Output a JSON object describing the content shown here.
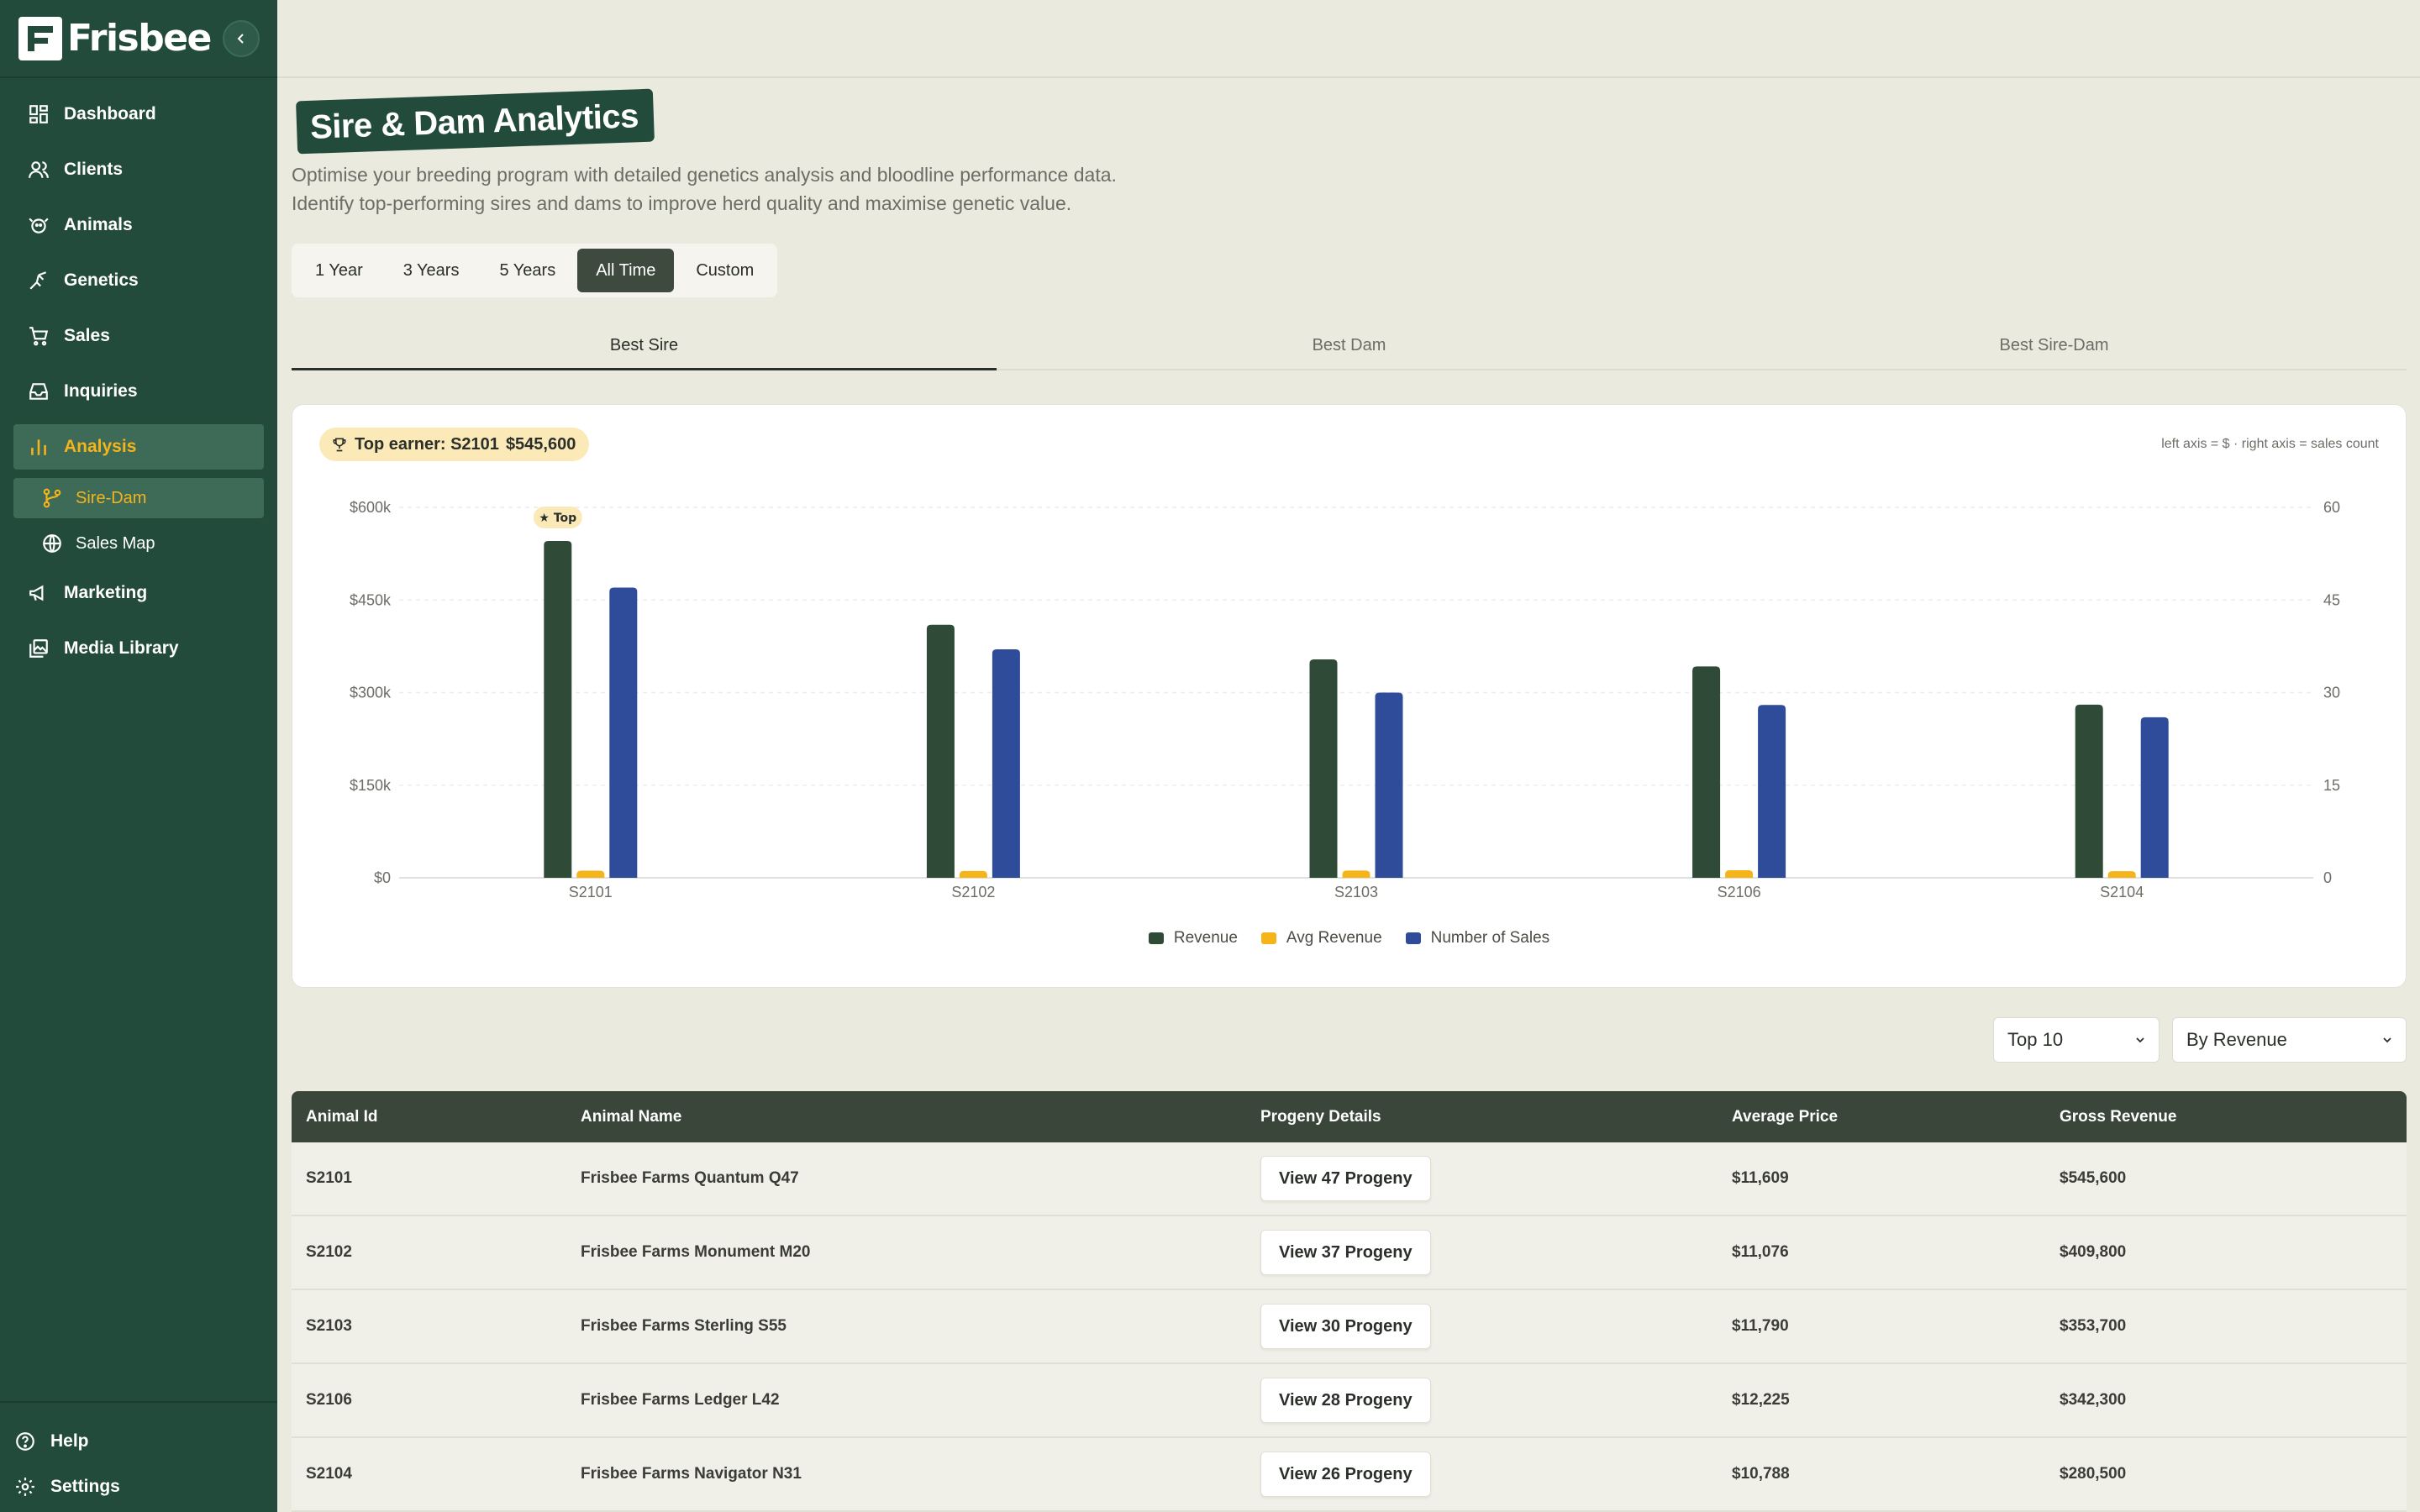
{
  "brand": {
    "name": "Frisbee"
  },
  "sidebar": {
    "items": [
      {
        "label": "Dashboard",
        "icon": "dashboard-icon"
      },
      {
        "label": "Clients",
        "icon": "users-icon"
      },
      {
        "label": "Animals",
        "icon": "animal-icon"
      },
      {
        "label": "Genetics",
        "icon": "genetics-icon"
      },
      {
        "label": "Sales",
        "icon": "cart-icon"
      },
      {
        "label": "Inquiries",
        "icon": "inbox-icon"
      },
      {
        "label": "Analysis",
        "icon": "bar-chart-icon",
        "active": true
      }
    ],
    "sub_items": [
      {
        "label": "Sire-Dam",
        "icon": "branch-icon",
        "active": true
      },
      {
        "label": "Sales Map",
        "icon": "globe-icon"
      }
    ],
    "items_after": [
      {
        "label": "Marketing",
        "icon": "megaphone-icon"
      },
      {
        "label": "Media Library",
        "icon": "images-icon"
      }
    ],
    "bottom": [
      {
        "label": "Help",
        "icon": "help-icon"
      },
      {
        "label": "Settings",
        "icon": "settings-icon"
      }
    ]
  },
  "page": {
    "title": "Sire & Dam Analytics",
    "subtitle_line1": "Optimise your breeding program with detailed genetics analysis and bloodline performance data.",
    "subtitle_line2": "Identify top-performing sires and dams to improve herd quality and maximise genetic value."
  },
  "period_tabs": [
    "1 Year",
    "3 Years",
    "5 Years",
    "All Time",
    "Custom"
  ],
  "period_active": "All Time",
  "view_tabs": [
    "Best Sire",
    "Best Dam",
    "Best Sire-Dam"
  ],
  "view_active": "Best Sire",
  "chart_card": {
    "top_earner_label": "Top earner: S2101",
    "top_earner_amount": "$545,600",
    "axis_note": "left axis = $ · right axis = sales count",
    "top_badge": "Top"
  },
  "chart_data": {
    "type": "bar",
    "categories": [
      "S2101",
      "S2102",
      "S2103",
      "S2106",
      "S2104"
    ],
    "series": [
      {
        "name": "Revenue",
        "axis": "left",
        "color": "#2f4a36",
        "values": [
          545600,
          409800,
          353700,
          342300,
          280500
        ]
      },
      {
        "name": "Avg Revenue",
        "axis": "left",
        "color": "#f4b41a",
        "values": [
          11609,
          11076,
          11790,
          12225,
          10788
        ]
      },
      {
        "name": "Number of Sales",
        "axis": "right",
        "color": "#2f4c9a",
        "values": [
          47,
          37,
          30,
          28,
          26
        ]
      }
    ],
    "y_left": {
      "ticks": [
        "$0",
        "$150k",
        "$300k",
        "$450k",
        "$600k"
      ],
      "range": [
        0,
        600000
      ]
    },
    "y_right": {
      "ticks": [
        "0",
        "15",
        "30",
        "45",
        "60"
      ],
      "range": [
        0,
        60
      ]
    },
    "grid": true,
    "legend": "bottom-center"
  },
  "controls": {
    "top_select": "Top 10",
    "sort_select": "By Revenue"
  },
  "table": {
    "columns": [
      "Animal Id",
      "Animal Name",
      "Progeny Details",
      "Average Price",
      "Gross Revenue"
    ],
    "rows": [
      {
        "id": "S2101",
        "name": "Frisbee Farms Quantum Q47",
        "progeny": "View 47 Progeny",
        "avg": "$11,609",
        "gross": "$545,600"
      },
      {
        "id": "S2102",
        "name": "Frisbee Farms Monument M20",
        "progeny": "View 37 Progeny",
        "avg": "$11,076",
        "gross": "$409,800"
      },
      {
        "id": "S2103",
        "name": "Frisbee Farms Sterling S55",
        "progeny": "View 30 Progeny",
        "avg": "$11,790",
        "gross": "$353,700"
      },
      {
        "id": "S2106",
        "name": "Frisbee Farms Ledger L42",
        "progeny": "View 28 Progeny",
        "avg": "$12,225",
        "gross": "$342,300"
      },
      {
        "id": "S2104",
        "name": "Frisbee Farms Navigator N31",
        "progeny": "View 26 Progeny",
        "avg": "$10,788",
        "gross": "$280,500"
      }
    ]
  }
}
